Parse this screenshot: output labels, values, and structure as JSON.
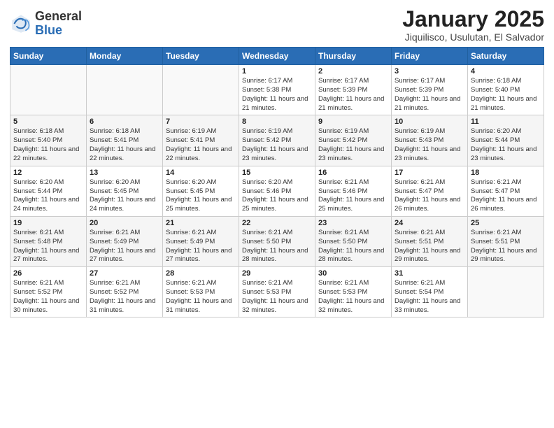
{
  "header": {
    "logo_general": "General",
    "logo_blue": "Blue",
    "month_title": "January 2025",
    "location": "Jiquilisco, Usulutan, El Salvador"
  },
  "weekdays": [
    "Sunday",
    "Monday",
    "Tuesday",
    "Wednesday",
    "Thursday",
    "Friday",
    "Saturday"
  ],
  "weeks": [
    [
      {
        "day": "",
        "info": ""
      },
      {
        "day": "",
        "info": ""
      },
      {
        "day": "",
        "info": ""
      },
      {
        "day": "1",
        "info": "Sunrise: 6:17 AM\nSunset: 5:38 PM\nDaylight: 11 hours and 21 minutes."
      },
      {
        "day": "2",
        "info": "Sunrise: 6:17 AM\nSunset: 5:39 PM\nDaylight: 11 hours and 21 minutes."
      },
      {
        "day": "3",
        "info": "Sunrise: 6:17 AM\nSunset: 5:39 PM\nDaylight: 11 hours and 21 minutes."
      },
      {
        "day": "4",
        "info": "Sunrise: 6:18 AM\nSunset: 5:40 PM\nDaylight: 11 hours and 21 minutes."
      }
    ],
    [
      {
        "day": "5",
        "info": "Sunrise: 6:18 AM\nSunset: 5:40 PM\nDaylight: 11 hours and 22 minutes."
      },
      {
        "day": "6",
        "info": "Sunrise: 6:18 AM\nSunset: 5:41 PM\nDaylight: 11 hours and 22 minutes."
      },
      {
        "day": "7",
        "info": "Sunrise: 6:19 AM\nSunset: 5:41 PM\nDaylight: 11 hours and 22 minutes."
      },
      {
        "day": "8",
        "info": "Sunrise: 6:19 AM\nSunset: 5:42 PM\nDaylight: 11 hours and 23 minutes."
      },
      {
        "day": "9",
        "info": "Sunrise: 6:19 AM\nSunset: 5:42 PM\nDaylight: 11 hours and 23 minutes."
      },
      {
        "day": "10",
        "info": "Sunrise: 6:19 AM\nSunset: 5:43 PM\nDaylight: 11 hours and 23 minutes."
      },
      {
        "day": "11",
        "info": "Sunrise: 6:20 AM\nSunset: 5:44 PM\nDaylight: 11 hours and 23 minutes."
      }
    ],
    [
      {
        "day": "12",
        "info": "Sunrise: 6:20 AM\nSunset: 5:44 PM\nDaylight: 11 hours and 24 minutes."
      },
      {
        "day": "13",
        "info": "Sunrise: 6:20 AM\nSunset: 5:45 PM\nDaylight: 11 hours and 24 minutes."
      },
      {
        "day": "14",
        "info": "Sunrise: 6:20 AM\nSunset: 5:45 PM\nDaylight: 11 hours and 25 minutes."
      },
      {
        "day": "15",
        "info": "Sunrise: 6:20 AM\nSunset: 5:46 PM\nDaylight: 11 hours and 25 minutes."
      },
      {
        "day": "16",
        "info": "Sunrise: 6:21 AM\nSunset: 5:46 PM\nDaylight: 11 hours and 25 minutes."
      },
      {
        "day": "17",
        "info": "Sunrise: 6:21 AM\nSunset: 5:47 PM\nDaylight: 11 hours and 26 minutes."
      },
      {
        "day": "18",
        "info": "Sunrise: 6:21 AM\nSunset: 5:47 PM\nDaylight: 11 hours and 26 minutes."
      }
    ],
    [
      {
        "day": "19",
        "info": "Sunrise: 6:21 AM\nSunset: 5:48 PM\nDaylight: 11 hours and 27 minutes."
      },
      {
        "day": "20",
        "info": "Sunrise: 6:21 AM\nSunset: 5:49 PM\nDaylight: 11 hours and 27 minutes."
      },
      {
        "day": "21",
        "info": "Sunrise: 6:21 AM\nSunset: 5:49 PM\nDaylight: 11 hours and 27 minutes."
      },
      {
        "day": "22",
        "info": "Sunrise: 6:21 AM\nSunset: 5:50 PM\nDaylight: 11 hours and 28 minutes."
      },
      {
        "day": "23",
        "info": "Sunrise: 6:21 AM\nSunset: 5:50 PM\nDaylight: 11 hours and 28 minutes."
      },
      {
        "day": "24",
        "info": "Sunrise: 6:21 AM\nSunset: 5:51 PM\nDaylight: 11 hours and 29 minutes."
      },
      {
        "day": "25",
        "info": "Sunrise: 6:21 AM\nSunset: 5:51 PM\nDaylight: 11 hours and 29 minutes."
      }
    ],
    [
      {
        "day": "26",
        "info": "Sunrise: 6:21 AM\nSunset: 5:52 PM\nDaylight: 11 hours and 30 minutes."
      },
      {
        "day": "27",
        "info": "Sunrise: 6:21 AM\nSunset: 5:52 PM\nDaylight: 11 hours and 31 minutes."
      },
      {
        "day": "28",
        "info": "Sunrise: 6:21 AM\nSunset: 5:53 PM\nDaylight: 11 hours and 31 minutes."
      },
      {
        "day": "29",
        "info": "Sunrise: 6:21 AM\nSunset: 5:53 PM\nDaylight: 11 hours and 32 minutes."
      },
      {
        "day": "30",
        "info": "Sunrise: 6:21 AM\nSunset: 5:53 PM\nDaylight: 11 hours and 32 minutes."
      },
      {
        "day": "31",
        "info": "Sunrise: 6:21 AM\nSunset: 5:54 PM\nDaylight: 11 hours and 33 minutes."
      },
      {
        "day": "",
        "info": ""
      }
    ]
  ]
}
